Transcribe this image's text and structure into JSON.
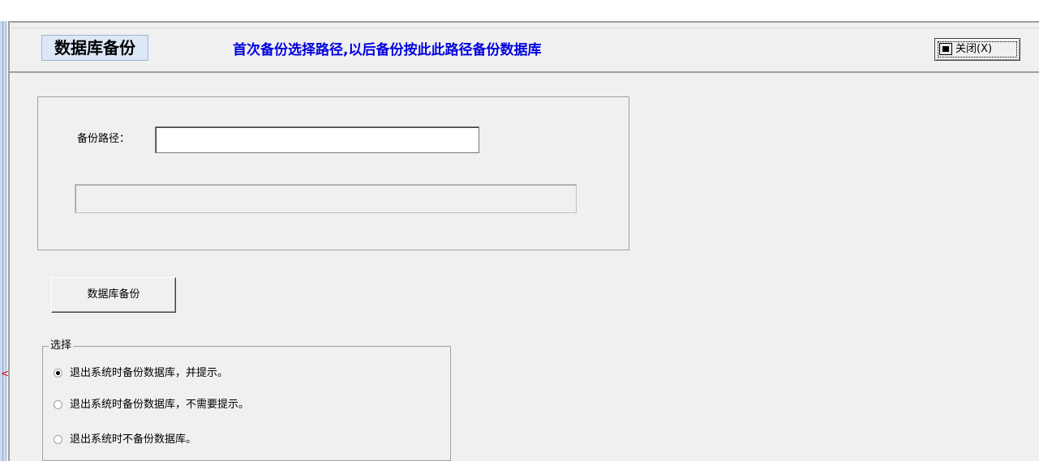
{
  "header": {
    "title": "数据库备份",
    "subtitle": "首次备份选择路径,以后备份按此此路径备份数据库",
    "close_label": "关闭(X)"
  },
  "backup_path": {
    "label": "备份路径：",
    "value": ""
  },
  "actions": {
    "backup_label": "数据库备份"
  },
  "options": {
    "legend": "选择",
    "items": [
      {
        "label": "退出系统时备份数据库，并提示。",
        "checked": true
      },
      {
        "label": "退出系统时备份数据库，不需要提示。",
        "checked": false
      },
      {
        "label": "退出系统时不备份数据库。",
        "checked": false
      }
    ]
  },
  "colors": {
    "subtitle": "#0000e0",
    "title_bg": "#dce8f6",
    "window_bg": "#f0f0f0",
    "collapse_arrow": "#e00000"
  },
  "icons": {
    "close": "close-icon",
    "collapse": "collapse-arrow-icon"
  }
}
